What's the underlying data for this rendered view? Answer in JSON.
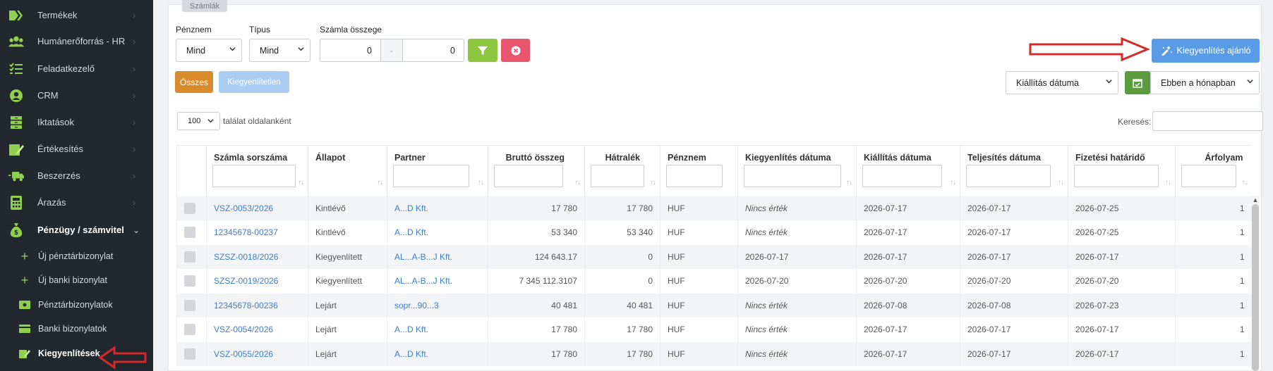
{
  "sidebar": {
    "items": [
      {
        "label": "Termékek",
        "icon": "tag-icon"
      },
      {
        "label": "Humánerőforrás - HR",
        "icon": "users-icon"
      },
      {
        "label": "Feladatkezelő",
        "icon": "tasklist-icon"
      },
      {
        "label": "CRM",
        "icon": "user-circle-icon"
      },
      {
        "label": "Iktatások",
        "icon": "archive-icon"
      },
      {
        "label": "Értékesítés",
        "icon": "sales-icon"
      },
      {
        "label": "Beszerzés",
        "icon": "truck-icon"
      },
      {
        "label": "Árazás",
        "icon": "calculator-icon"
      },
      {
        "label": "Pénzügy / számvitel",
        "icon": "money-bag-icon"
      }
    ],
    "subitems": [
      {
        "label": "Új pénztárbizonylat",
        "icon": "plus-icon"
      },
      {
        "label": "Új banki bizonylat",
        "icon": "plus-icon"
      },
      {
        "label": "Pénztárbizonylatok",
        "icon": "cash-icon"
      },
      {
        "label": "Banki bizonylatok",
        "icon": "card-icon"
      },
      {
        "label": "Kiegyenlítések",
        "icon": "edit-icon"
      }
    ]
  },
  "tab": {
    "label": "Számlák"
  },
  "filters": {
    "currency_label": "Pénznem",
    "currency_value": "Mind",
    "type_label": "Típus",
    "type_value": "Mind",
    "amount_label": "Számla összege",
    "amount_from": "0",
    "amount_to": "0",
    "amount_sep": "-"
  },
  "buttons": {
    "all": "Összes",
    "unsettled": "Kiegyenlítetlen",
    "recommend": "Kiegyenlítés ajánló"
  },
  "date_filter": {
    "field": "Kiállítás dátuma",
    "period": "Ebben a hónapban"
  },
  "paging": {
    "page_size": "100",
    "per_page_text": "találat oldalanként",
    "search_label": "Keresés:"
  },
  "table": {
    "columns": [
      "Számla sorszáma",
      "Állapot",
      "Partner",
      "Bruttó összeg",
      "Hátralék",
      "Pénznem",
      "Kiegyenlítés dátuma",
      "Kiállítás dátuma",
      "Teljesítés dátuma",
      "Fizetési határidő",
      "Árfolyam"
    ],
    "rows": [
      [
        "VSZ-0053/2026",
        "Kintlévő",
        "A...D Kft.",
        "17 780",
        "17 780",
        "HUF",
        "Nincs érték",
        "2026-07-17",
        "2026-07-17",
        "2026-07-25",
        "1"
      ],
      [
        "12345678-00237",
        "Kintlévő",
        "A...D Kft.",
        "53 340",
        "53 340",
        "HUF",
        "Nincs érték",
        "2026-07-17",
        "2026-07-17",
        "2026-07-25",
        "1"
      ],
      [
        "SZSZ-0018/2026",
        "Kiegyenlített",
        "AL...A-B...J Kft.",
        "124 643.17",
        "0",
        "HUF",
        "2026-07-17",
        "2026-07-17",
        "2026-07-17",
        "2026-07-17",
        "1"
      ],
      [
        "SZSZ-0019/2026",
        "Kiegyenlített",
        "AL...A-B...J Kft.",
        "7 345 112.3107",
        "0",
        "HUF",
        "2026-07-20",
        "2026-07-20",
        "2026-07-20",
        "2026-07-20",
        "1"
      ],
      [
        "12345678-00236",
        "Lejárt",
        "sopr...90...3",
        "40 481",
        "40 481",
        "HUF",
        "Nincs érték",
        "2026-07-08",
        "2026-07-08",
        "2026-07-23",
        "1"
      ],
      [
        "VSZ-0054/2026",
        "Lejárt",
        "A...D Kft.",
        "17 780",
        "17 780",
        "HUF",
        "Nincs érték",
        "2026-07-17",
        "2026-07-17",
        "2026-07-17",
        "1"
      ],
      [
        "VSZ-0055/2026",
        "Lejárt",
        "A...D Kft.",
        "17 780",
        "17 780",
        "HUF",
        "Nincs érték",
        "2026-07-17",
        "2026-07-17",
        "2026-07-17",
        "1"
      ]
    ]
  },
  "colors": {
    "sidebar_bg": "#23272e",
    "accent_green": "#8fd14f",
    "orange": "#d98b2b",
    "blue": "#5a9be6",
    "red": "#e7556e",
    "link": "#3b7ec9"
  }
}
